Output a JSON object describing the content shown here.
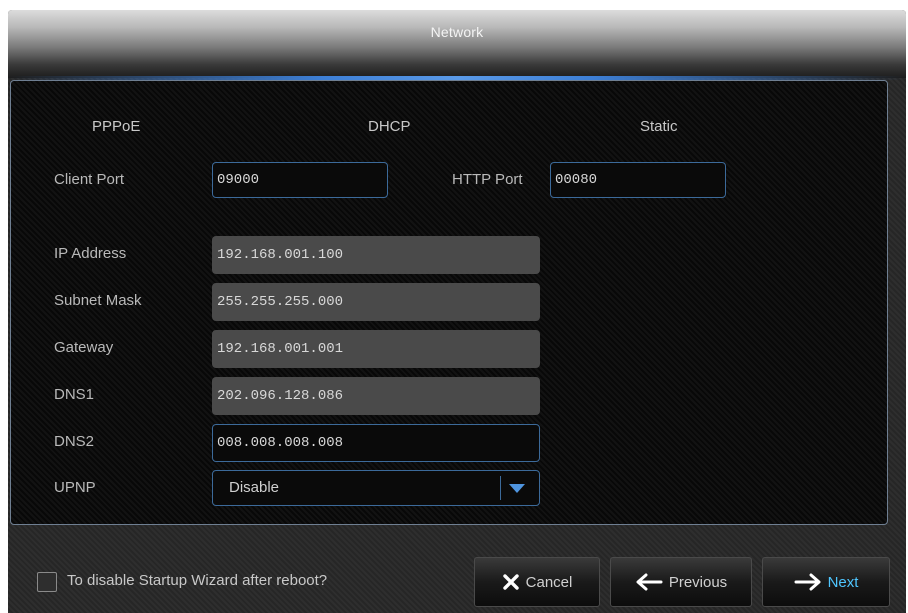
{
  "window": {
    "title": "Network"
  },
  "modes": [
    "PPPoE",
    "DHCP",
    "Static"
  ],
  "ports": {
    "client_label": "Client Port",
    "client_value": "09000",
    "http_label": "HTTP Port",
    "http_value": "00080"
  },
  "fields": [
    {
      "label": "IP Address",
      "value": "192.168.001.100"
    },
    {
      "label": "Subnet Mask",
      "value": "255.255.255.000"
    },
    {
      "label": "Gateway",
      "value": "192.168.001.001"
    },
    {
      "label": "DNS1",
      "value": "202.096.128.086"
    },
    {
      "label": "DNS2",
      "value": "008.008.008.008"
    }
  ],
  "upnp": {
    "label": "UPNP",
    "value": "Disable"
  },
  "footer": {
    "checkbox_label": "To disable Startup Wizard after reboot?",
    "cancel": "Cancel",
    "previous": "Previous",
    "next": "Next"
  },
  "colors": {
    "accent": "#3d7fd6",
    "next_text": "#4fc6ff",
    "field_border": "#3c6a9a"
  },
  "icons": [
    "close-icon",
    "arrow-left-icon",
    "arrow-right-icon",
    "chevron-down-icon"
  ]
}
